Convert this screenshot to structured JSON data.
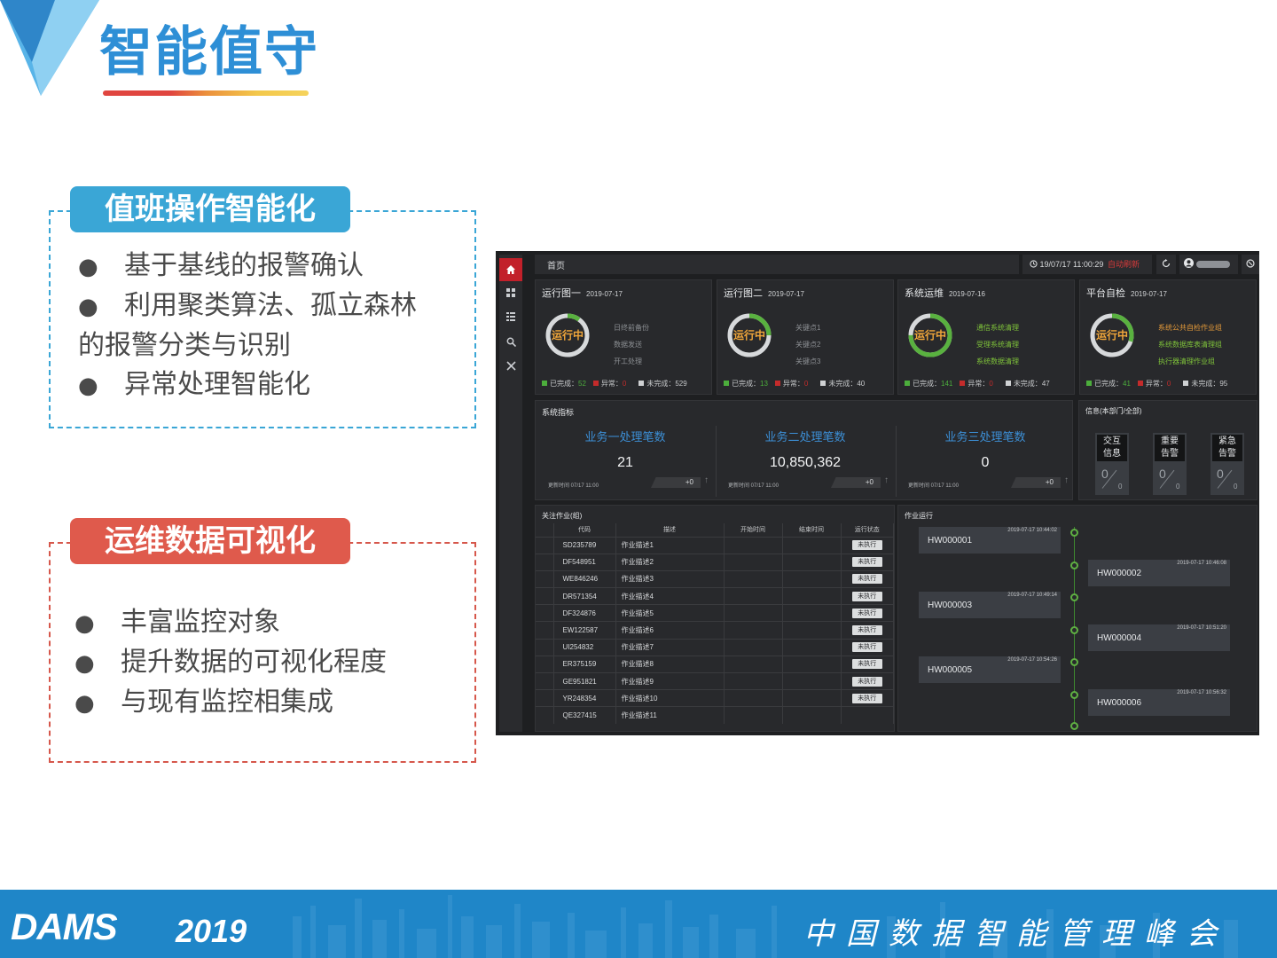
{
  "slide": {
    "title": "智能值守",
    "section1": {
      "heading": "值班操作智能化",
      "bullets": [
        "基于基线的报警确认",
        "利用聚类算法、孤立森林",
        "的报警分类与识别",
        "异常处理智能化"
      ]
    },
    "section2": {
      "heading": "运维数据可视化",
      "bullets": [
        "丰富监控对象",
        "提升数据的可视化程度",
        "与现有监控相集成"
      ]
    },
    "bullet_glyph": "●",
    "footer": {
      "brand": "DAMS",
      "year": "2019",
      "conference": "中国数据智能管理峰会"
    }
  },
  "dashboard": {
    "breadcrumb": "首页",
    "datetime": "19/07/17 11:00:29",
    "auto_refresh": "自动刷新",
    "sidebar_icons": [
      "home-icon",
      "grid-icon",
      "list-icon",
      "search-icon",
      "tools-icon"
    ],
    "ops_cards": [
      {
        "title": "运行图一",
        "date": "2019-07-17",
        "status": "运行中",
        "progress": 0.1,
        "items": [
          "日终前备份",
          "数据发送",
          "开工处理"
        ],
        "item_color": "gray",
        "done_label": "已完成：",
        "done": "52",
        "err_label": "异常：",
        "err": "0",
        "todo_label": "未完成：",
        "todo": "529"
      },
      {
        "title": "运行图二",
        "date": "2019-07-17",
        "status": "运行中",
        "progress": 0.25,
        "items": [
          "关键点1",
          "关键点2",
          "关键点3"
        ],
        "item_color": "gray",
        "done_label": "已完成：",
        "done": "13",
        "err_label": "异常：",
        "err": "0",
        "todo_label": "未完成：",
        "todo": "40"
      },
      {
        "title": "系统运维",
        "date": "2019-07-16",
        "status": "运行中",
        "progress": 0.75,
        "items": [
          "通信系统清理",
          "受理系统清理",
          "系统数据清理"
        ],
        "item_color": "lime",
        "done_label": "已完成：",
        "done": "141",
        "err_label": "异常：",
        "err": "0",
        "todo_label": "未完成：",
        "todo": "47"
      },
      {
        "title": "平台自检",
        "date": "2019-07-17",
        "status": "运行中",
        "progress": 0.3,
        "items": [
          "系统公共自检作业组",
          "系统数据库表清理组",
          "执行器清理作业组"
        ],
        "item_color": "mixed",
        "done_label": "已完成：",
        "done": "41",
        "err_label": "异常：",
        "err": "0",
        "todo_label": "未完成：",
        "todo": "95"
      }
    ],
    "metrics_title": "系统指标",
    "metrics": [
      {
        "title": "业务一处理笔数",
        "value": "21",
        "updated": "更新时间 07/17 11:00",
        "delta": "+0"
      },
      {
        "title": "业务二处理笔数",
        "value": "10,850,362",
        "updated": "更新时间 07/17 11:00",
        "delta": "+0"
      },
      {
        "title": "业务三处理笔数",
        "value": "0",
        "updated": "更新时间 07/17 11:00",
        "delta": "+0"
      }
    ],
    "info_title": "信息(本部门/全部)",
    "info_boxes": [
      {
        "line1": "交互",
        "line2": "信息",
        "dept": "0",
        "all": "0"
      },
      {
        "line1": "重要",
        "line2": "告警",
        "dept": "0",
        "all": "0"
      },
      {
        "line1": "紧急",
        "line2": "告警",
        "dept": "0",
        "all": "0"
      }
    ],
    "jobs_title": "关注作业(组)",
    "jobs_columns": [
      "代码",
      "描述",
      "开始时间",
      "结束时间",
      "运行状态"
    ],
    "jobs": [
      {
        "code": "SD235789",
        "desc": "作业描述1",
        "status": "未执行"
      },
      {
        "code": "DF548951",
        "desc": "作业描述2",
        "status": "未执行"
      },
      {
        "code": "WE846246",
        "desc": "作业描述3",
        "status": "未执行"
      },
      {
        "code": "DR571354",
        "desc": "作业描述4",
        "status": "未执行"
      },
      {
        "code": "DF324876",
        "desc": "作业描述5",
        "status": "未执行"
      },
      {
        "code": "EW122587",
        "desc": "作业描述6",
        "status": "未执行"
      },
      {
        "code": "UI254832",
        "desc": "作业描述7",
        "status": "未执行"
      },
      {
        "code": "ER375159",
        "desc": "作业描述8",
        "status": "未执行"
      },
      {
        "code": "GE951821",
        "desc": "作业描述9",
        "status": "未执行"
      },
      {
        "code": "YR248354",
        "desc": "作业描述10",
        "status": "未执行"
      },
      {
        "code": "QE327415",
        "desc": "作业描述11",
        "status": ""
      }
    ],
    "timeline_title": "作业运行",
    "timeline": [
      {
        "code": "HW000001",
        "time": "2019-07-17 10:44:02",
        "side": "left"
      },
      {
        "code": "HW000002",
        "time": "2019-07-17 10:46:08",
        "side": "right"
      },
      {
        "code": "HW000003",
        "time": "2019-07-17 10:49:14",
        "side": "left"
      },
      {
        "code": "HW000004",
        "time": "2019-07-17 10:51:20",
        "side": "right"
      },
      {
        "code": "HW000005",
        "time": "2019-07-17 10:54:26",
        "side": "left"
      },
      {
        "code": "HW000006",
        "time": "2019-07-17 10:56:32",
        "side": "right"
      }
    ]
  }
}
